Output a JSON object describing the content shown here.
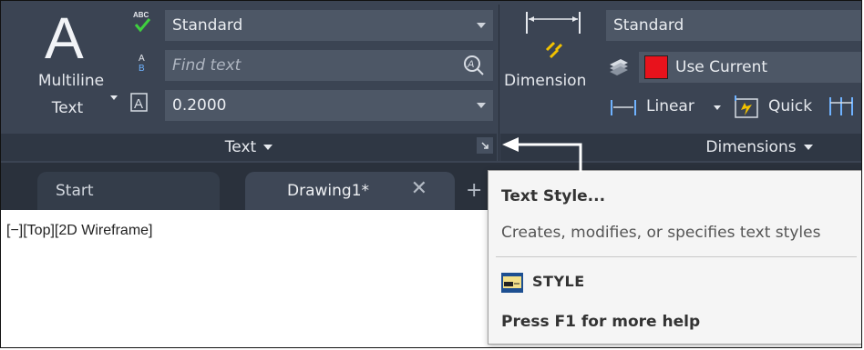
{
  "ribbon": {
    "text_panel": {
      "big_button_label_line1": "Multiline",
      "big_button_label_line2": "Text",
      "style_value": "Standard",
      "find_placeholder": "Find text",
      "height_value": "0.2000",
      "panel_title": "Text"
    },
    "dimensions_panel": {
      "big_button_label": "Dimension",
      "style_value": "Standard",
      "layer_value": "Use Current",
      "layer_color": "#e8121c",
      "linear_label": "Linear",
      "quick_label": "Quick",
      "panel_title": "Dimensions"
    }
  },
  "tabs": {
    "start": "Start",
    "drawing": "Drawing1*"
  },
  "viewport": {
    "label": "[−][Top][2D Wireframe]"
  },
  "tooltip": {
    "title": "Text Style...",
    "description": "Creates, modifies, or specifies text styles",
    "command": "STYLE",
    "help": "Press F1 for more help"
  },
  "colors": {
    "ribbon_bg": "#3b4453",
    "panel_bar_bg": "#2f3744",
    "tab_bar_bg": "#2a313c",
    "tooltip_bg": "#f5f5f5"
  }
}
